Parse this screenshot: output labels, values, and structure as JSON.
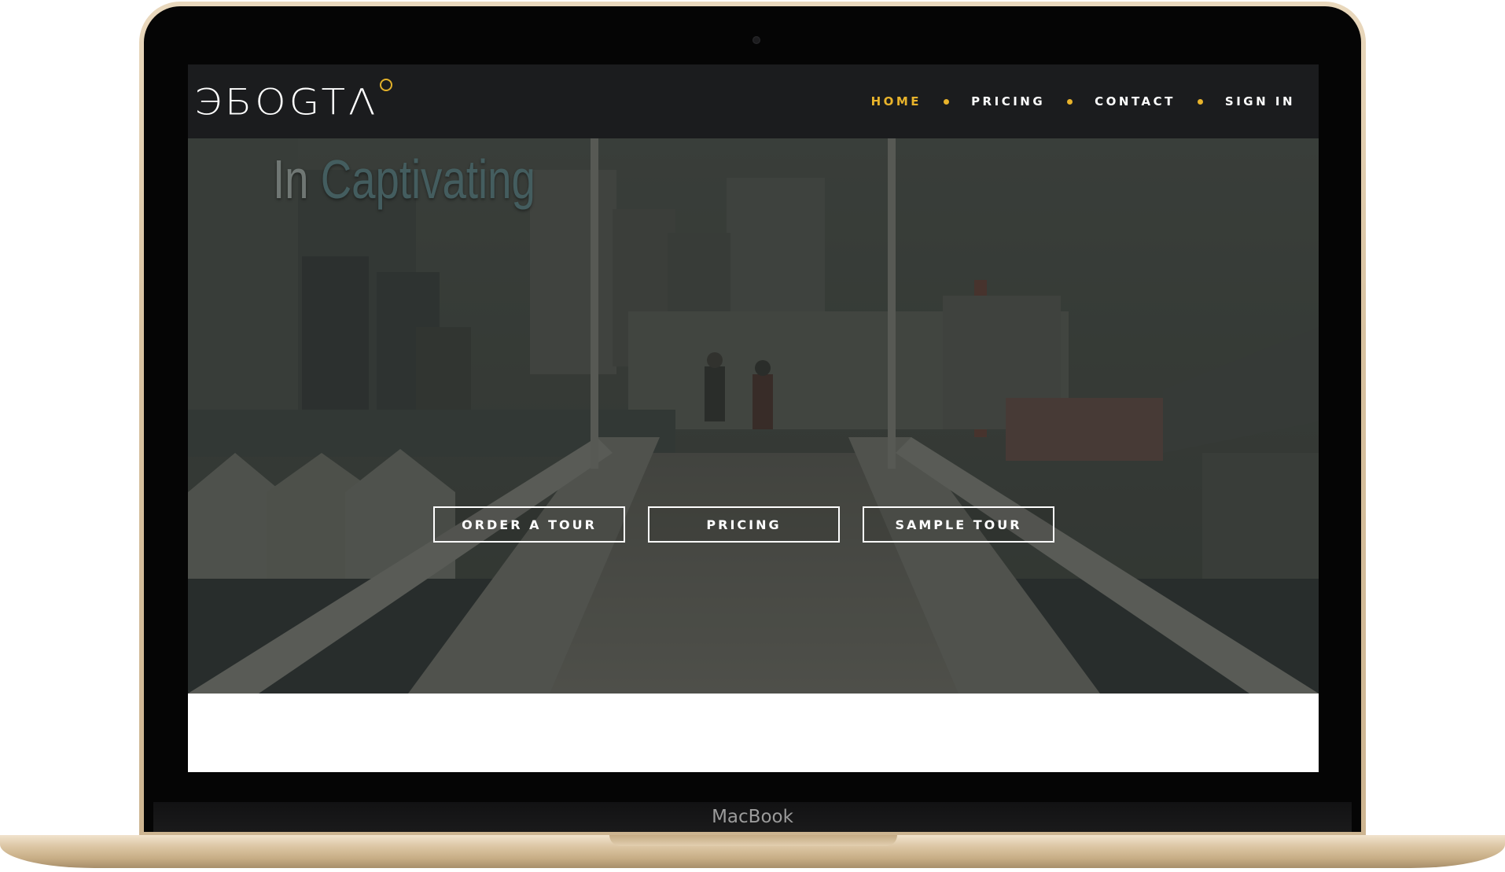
{
  "device": {
    "label": "MacBook"
  },
  "site": {
    "logo_text": "ЭБОGTΛ"
  },
  "nav": {
    "items": [
      {
        "label": "HOME",
        "active": true
      },
      {
        "label": "PRICING",
        "active": false
      },
      {
        "label": "CONTACT",
        "active": false
      },
      {
        "label": "SIGN IN",
        "active": false
      }
    ]
  },
  "hero": {
    "headline_part1": "In",
    "headline_part2": "Captivating",
    "buttons": [
      {
        "label": "ORDER A TOUR"
      },
      {
        "label": "PRICING"
      },
      {
        "label": "SAMPLE TOUR"
      }
    ]
  },
  "colors": {
    "accent": "#e8b32b",
    "navbar_bg": "#1b1c1e",
    "frame_gold": "#d8c2a1"
  }
}
